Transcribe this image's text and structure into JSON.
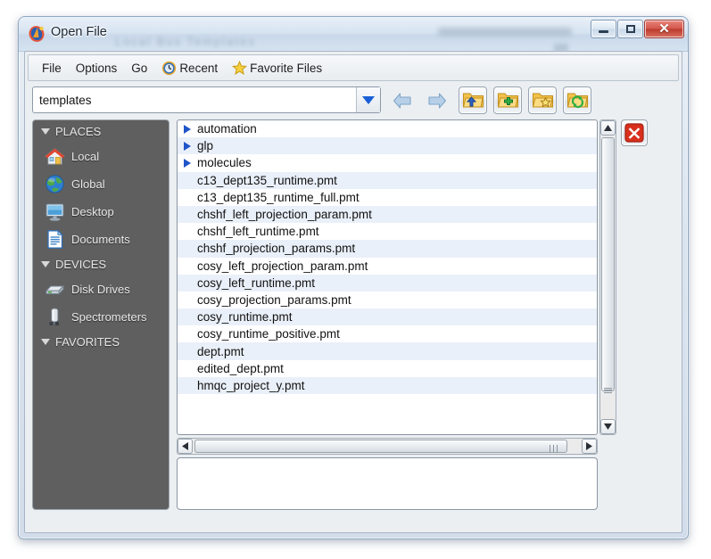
{
  "window": {
    "title": "Open File",
    "app_icon": "app-logo-icon",
    "ghost_text": "Local  Bus  Templates",
    "controls": {
      "minimize": "minimize-icon",
      "maximize": "maximize-icon",
      "close": "✕"
    }
  },
  "menubar": {
    "items": [
      {
        "label": "File",
        "icon": null
      },
      {
        "label": "Options",
        "icon": null
      },
      {
        "label": "Go",
        "icon": null
      },
      {
        "label": "Recent",
        "icon": "clock-icon"
      },
      {
        "label": "Favorite Files",
        "icon": "star-icon"
      }
    ]
  },
  "pathbar": {
    "value": "templates",
    "placeholder": "templates",
    "dropdown_icon": "chevron-down-icon",
    "buttons": [
      {
        "name": "back-button",
        "icon": "arrow-left-icon"
      },
      {
        "name": "forward-button",
        "icon": "arrow-right-icon"
      },
      {
        "name": "parent-folder-button",
        "icon": "folder-up-icon"
      },
      {
        "name": "new-folder-button",
        "icon": "folder-add-icon"
      },
      {
        "name": "favorite-folder-button",
        "icon": "folder-star-icon"
      },
      {
        "name": "refresh-folder-button",
        "icon": "folder-refresh-icon"
      }
    ]
  },
  "sidebar": {
    "sections": [
      {
        "title": "PLACES",
        "expanded": true,
        "items": [
          {
            "label": "Local",
            "icon": "house-icon"
          },
          {
            "label": "Global",
            "icon": "globe-icon"
          },
          {
            "label": "Desktop",
            "icon": "monitor-icon"
          },
          {
            "label": "Documents",
            "icon": "document-icon"
          }
        ]
      },
      {
        "title": "DEVICES",
        "expanded": true,
        "items": [
          {
            "label": "Disk Drives",
            "icon": "disk-drive-icon"
          },
          {
            "label": "Spectrometers",
            "icon": "spectrometer-icon"
          }
        ]
      },
      {
        "title": "FAVORITES",
        "expanded": true,
        "items": []
      }
    ]
  },
  "filelist": {
    "entries": [
      {
        "name": "automation",
        "type": "folder"
      },
      {
        "name": "glp",
        "type": "folder"
      },
      {
        "name": "molecules",
        "type": "folder"
      },
      {
        "name": "c13_dept135_runtime.pmt",
        "type": "file"
      },
      {
        "name": "c13_dept135_runtime_full.pmt",
        "type": "file"
      },
      {
        "name": "chshf_left_projection_param.pmt",
        "type": "file"
      },
      {
        "name": "chshf_left_runtime.pmt",
        "type": "file"
      },
      {
        "name": "chshf_projection_params.pmt",
        "type": "file"
      },
      {
        "name": "cosy_left_projection_param.pmt",
        "type": "file"
      },
      {
        "name": "cosy_left_runtime.pmt",
        "type": "file"
      },
      {
        "name": "cosy_projection_params.pmt",
        "type": "file"
      },
      {
        "name": "cosy_runtime.pmt",
        "type": "file"
      },
      {
        "name": "cosy_runtime_positive.pmt",
        "type": "file"
      },
      {
        "name": "dept.pmt",
        "type": "file"
      },
      {
        "name": "edited_dept.pmt",
        "type": "file"
      },
      {
        "name": "hmqc_project_y.pmt",
        "type": "file"
      }
    ]
  },
  "scrollbars": {
    "vertical": {
      "up_icon": "triangle-up-icon",
      "down_icon": "triangle-down-icon"
    },
    "horizontal": {
      "left_icon": "triangle-left-icon",
      "right_icon": "triangle-right-icon"
    }
  },
  "preview": {
    "value": ""
  },
  "cancel": {
    "icon": "close-x-icon",
    "label": ""
  },
  "colors": {
    "accent_blue": "#1a5fd8",
    "sidebar_bg": "#5f5f5f",
    "row_stripe": "#eaf0f9",
    "close_red": "#d4564a",
    "folder_yellow": "#f2c14a"
  }
}
